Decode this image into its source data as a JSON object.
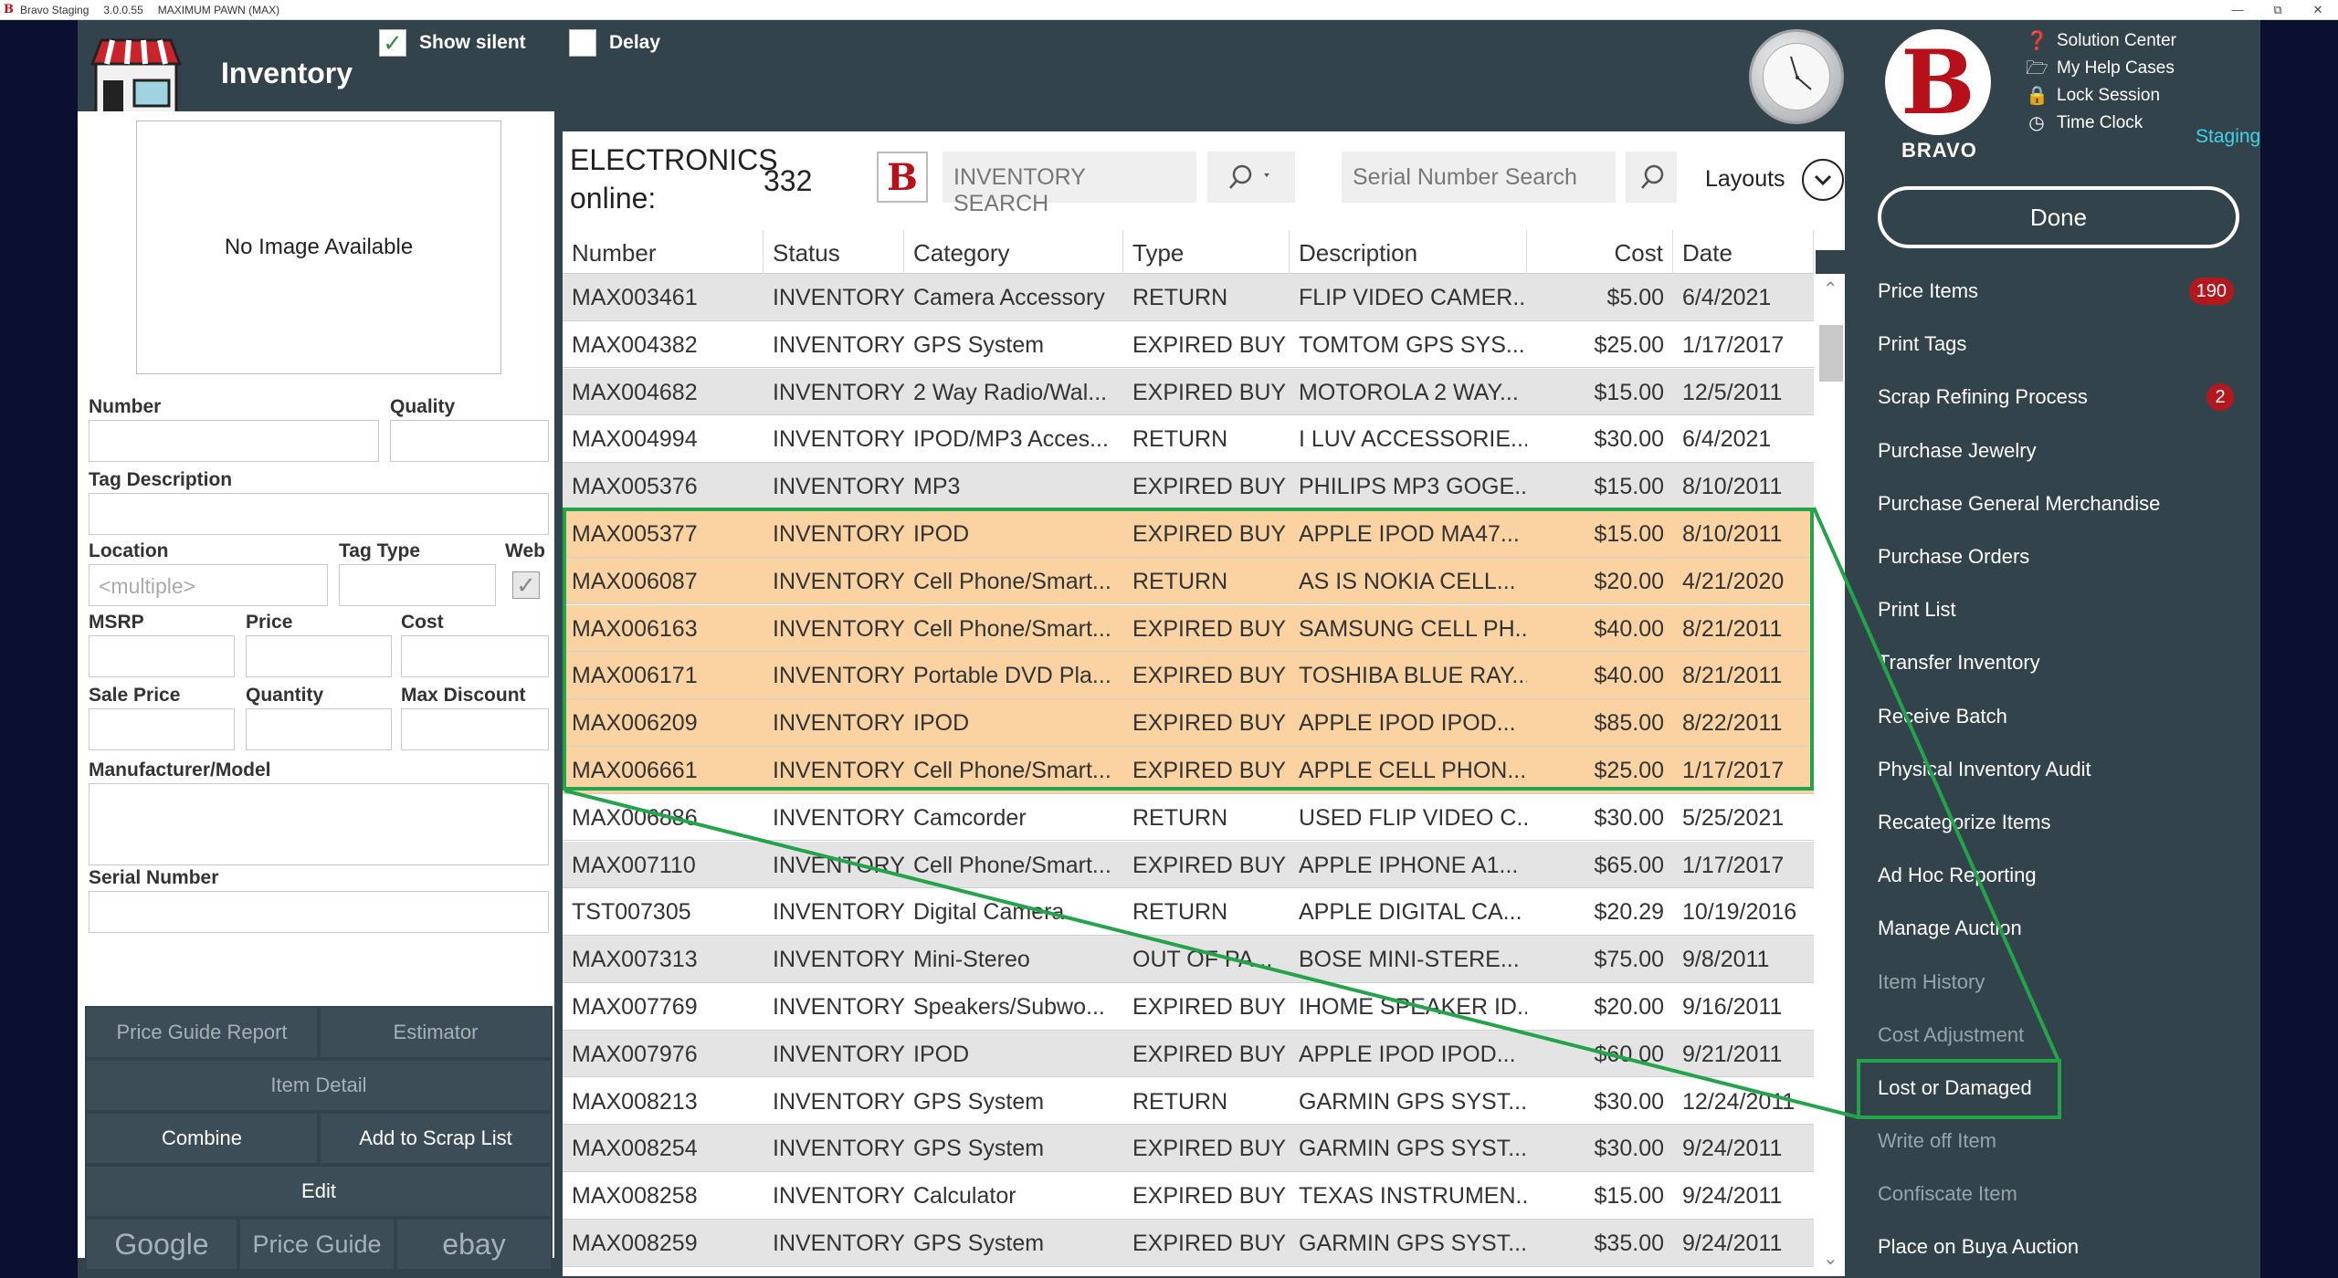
{
  "titlebar": {
    "app": "Bravo Staging",
    "version": "3.0.0.55",
    "store": "MAXIMUM PAWN (MAX)"
  },
  "header": {
    "title": "Inventory",
    "show_silent": "Show silent",
    "delay": "Delay"
  },
  "left": {
    "no_image": "No Image Available",
    "labels": {
      "number": "Number",
      "quality": "Quality",
      "tag_description": "Tag Description",
      "location": "Location",
      "tag_type": "Tag Type",
      "web": "Web",
      "msrp": "MSRP",
      "price": "Price",
      "cost": "Cost",
      "sale_price": "Sale Price",
      "quantity": "Quantity",
      "max_discount": "Max Discount",
      "manufacturer_model": "Manufacturer/Model",
      "serial_number": "Serial Number"
    },
    "location_value": "<multiple>",
    "buttons": {
      "price_guide_report": "Price Guide Report",
      "estimator": "Estimator",
      "item_detail": "Item Detail",
      "combine": "Combine",
      "add_to_scrap": "Add to Scrap List",
      "edit": "Edit",
      "google": "Google",
      "price_guide": "Price Guide",
      "ebay": "ebay"
    }
  },
  "search": {
    "category": "ELECTRONICS online:",
    "count": "332",
    "inventory_placeholder": "INVENTORY SEARCH",
    "serial_placeholder": "Serial Number Search",
    "layouts": "Layouts"
  },
  "table": {
    "columns": [
      "Number",
      "Status",
      "Category",
      "Type",
      "Description",
      "Cost",
      "Date"
    ],
    "rows": [
      [
        "MAX003461",
        "INVENTORY",
        "Camera Accessory",
        "RETURN",
        "FLIP VIDEO CAMER...",
        "$5.00",
        "6/4/2021"
      ],
      [
        "MAX004382",
        "INVENTORY",
        "GPS System",
        "EXPIRED BUY",
        "TOMTOM GPS SYS...",
        "$25.00",
        "1/17/2017"
      ],
      [
        "MAX004682",
        "INVENTORY",
        "2 Way Radio/Wal...",
        "EXPIRED BUY",
        "MOTOROLA 2 WAY...",
        "$15.00",
        "12/5/2011"
      ],
      [
        "MAX004994",
        "INVENTORY",
        "IPOD/MP3 Acces...",
        "RETURN",
        "I LUV ACCESSORIE...",
        "$30.00",
        "6/4/2021"
      ],
      [
        "MAX005376",
        "INVENTORY",
        "MP3",
        "EXPIRED BUY",
        "PHILIPS MP3 GOGE...",
        "$15.00",
        "8/10/2011"
      ],
      [
        "MAX005377",
        "INVENTORY",
        "IPOD",
        "EXPIRED BUY",
        "APPLE IPOD MA47...",
        "$15.00",
        "8/10/2011"
      ],
      [
        "MAX006087",
        "INVENTORY",
        "Cell Phone/Smart...",
        "RETURN",
        "AS IS NOKIA CELL...",
        "$20.00",
        "4/21/2020"
      ],
      [
        "MAX006163",
        "INVENTORY",
        "Cell Phone/Smart...",
        "EXPIRED BUY",
        "SAMSUNG CELL PH...",
        "$40.00",
        "8/21/2011"
      ],
      [
        "MAX006171",
        "INVENTORY",
        "Portable DVD Pla...",
        "EXPIRED BUY",
        "TOSHIBA BLUE RAY...",
        "$40.00",
        "8/21/2011"
      ],
      [
        "MAX006209",
        "INVENTORY",
        "IPOD",
        "EXPIRED BUY",
        "APPLE IPOD IPOD...",
        "$85.00",
        "8/22/2011"
      ],
      [
        "MAX006661",
        "INVENTORY",
        "Cell Phone/Smart...",
        "EXPIRED BUY",
        "APPLE CELL PHON...",
        "$25.00",
        "1/17/2017"
      ],
      [
        "MAX006886",
        "INVENTORY",
        "Camcorder",
        "RETURN",
        "USED FLIP VIDEO C...",
        "$30.00",
        "5/25/2021"
      ],
      [
        "MAX007110",
        "INVENTORY",
        "Cell Phone/Smart...",
        "EXPIRED BUY",
        "APPLE  IPHONE A1...",
        "$65.00",
        "1/17/2017"
      ],
      [
        "TST007305",
        "INVENTORY",
        "Digital Camera",
        "RETURN",
        "APPLE DIGITAL CA...",
        "$20.29",
        "10/19/2016"
      ],
      [
        "MAX007313",
        "INVENTORY",
        "Mini-Stereo",
        "OUT OF PA...",
        "BOSE MINI-STERE...",
        "$75.00",
        "9/8/2011"
      ],
      [
        "MAX007769",
        "INVENTORY",
        "Speakers/Subwo...",
        "EXPIRED BUY",
        "IHOME SPEAKER ID...",
        "$20.00",
        "9/16/2011"
      ],
      [
        "MAX007976",
        "INVENTORY",
        "IPOD",
        "EXPIRED BUY",
        "APPLE IPOD IPOD...",
        "$60.00",
        "9/21/2011"
      ],
      [
        "MAX008213",
        "INVENTORY",
        "GPS System",
        "RETURN",
        "GARMIN GPS SYST...",
        "$30.00",
        "12/24/2011"
      ],
      [
        "MAX008254",
        "INVENTORY",
        "GPS System",
        "EXPIRED BUY",
        "GARMIN GPS SYST...",
        "$30.00",
        "9/24/2011"
      ],
      [
        "MAX008258",
        "INVENTORY",
        "Calculator",
        "EXPIRED BUY",
        "TEXAS INSTRUMEN...",
        "$15.00",
        "9/24/2011"
      ],
      [
        "MAX008259",
        "INVENTORY",
        "GPS System",
        "EXPIRED BUY",
        "GARMIN GPS SYST...",
        "$35.00",
        "9/24/2011"
      ]
    ],
    "selected_rows": [
      5,
      6,
      7,
      8,
      9,
      10
    ]
  },
  "right": {
    "brand": "BRAVO",
    "links": [
      "Solution Center",
      "My Help Cases",
      "Lock Session",
      "Time Clock"
    ],
    "staging": "Staging",
    "done": "Done",
    "menu": [
      {
        "label": "Price Items",
        "badge": "190",
        "dim": false
      },
      {
        "label": "Print Tags",
        "badge": "",
        "dim": false
      },
      {
        "label": "Scrap Refining Process",
        "badge": "2",
        "dim": false
      },
      {
        "label": "Purchase Jewelry",
        "badge": "",
        "dim": false
      },
      {
        "label": "Purchase General Merchandise",
        "badge": "",
        "dim": false
      },
      {
        "label": "Purchase Orders",
        "badge": "",
        "dim": false
      },
      {
        "label": "Print List",
        "badge": "",
        "dim": false
      },
      {
        "label": "Transfer Inventory",
        "badge": "",
        "dim": false
      },
      {
        "label": "Receive Batch",
        "badge": "",
        "dim": false
      },
      {
        "label": "Physical Inventory Audit",
        "badge": "",
        "dim": false
      },
      {
        "label": "Recategorize Items",
        "badge": "",
        "dim": false
      },
      {
        "label": "Ad Hoc Reporting",
        "badge": "",
        "dim": false
      },
      {
        "label": "Manage Auction",
        "badge": "",
        "dim": false
      },
      {
        "label": "Item History",
        "badge": "",
        "dim": true
      },
      {
        "label": "Cost Adjustment",
        "badge": "",
        "dim": true
      },
      {
        "label": "Lost or Damaged",
        "badge": "",
        "dim": false
      },
      {
        "label": "Write off Item",
        "badge": "",
        "dim": true
      },
      {
        "label": "Confiscate Item",
        "badge": "",
        "dim": true
      },
      {
        "label": "Place on Buya Auction",
        "badge": "",
        "dim": false
      }
    ]
  },
  "colors": {
    "panel": "#33434c",
    "selected_row": "#fbd3a2",
    "highlight": "#23a34a",
    "badge": "#b3181e",
    "staging": "#3fd4e8"
  }
}
